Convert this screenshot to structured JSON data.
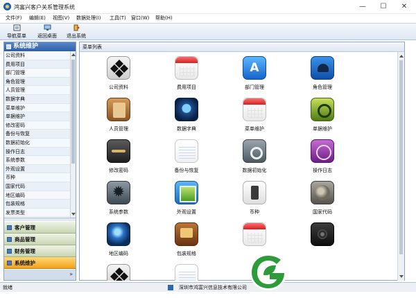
{
  "window": {
    "title": "鸿富兴客户关系管理系统",
    "controls": [
      "—",
      "☐",
      "✕"
    ]
  },
  "menu": [
    "文件(F)",
    "编辑(E)",
    "视图(V)",
    "数据处理(I)",
    "工具(T)",
    "窗口(W)",
    "帮助(H)"
  ],
  "toolbar": {
    "nav_menu": "导航菜单",
    "back_desktop": "返回桌面",
    "exit_system": "退出系统"
  },
  "sidebar": {
    "header": "系统维护",
    "items": [
      "公司资料",
      "费用项目",
      "部门管理",
      "角色管理",
      "人员管理",
      "数据字典",
      "菜单维护",
      "单据维护",
      "修改密码",
      "备份与恢复",
      "数据初始化",
      "操作日志",
      "系统参数",
      "外观设置",
      "币种",
      "国家代码",
      "地区编码",
      "包装规格",
      "发票类型"
    ],
    "sections": [
      {
        "label": "客户管理",
        "active": false
      },
      {
        "label": "商品管理",
        "active": false
      },
      {
        "label": "财务管理",
        "active": false
      },
      {
        "label": "系统维护",
        "active": true
      }
    ]
  },
  "main": {
    "header": "菜单列表",
    "tiles": [
      {
        "label": "公司资料",
        "icon": "black-diamond-icon"
      },
      {
        "label": "费用项目",
        "icon": "calendar-icon"
      },
      {
        "label": "部门管理",
        "icon": "app-store-icon"
      },
      {
        "label": "角色管理",
        "icon": "people-icon"
      },
      {
        "label": "人员管理",
        "icon": "address-book-icon"
      },
      {
        "label": "数据字典",
        "icon": "globe-icon"
      },
      {
        "label": "菜单维护",
        "icon": "calendar-icon"
      },
      {
        "label": "单据维护",
        "icon": "headphones-icon"
      },
      {
        "label": "修改密码",
        "icon": "key-icon"
      },
      {
        "label": "备份与恢复",
        "icon": "notebook-icon"
      },
      {
        "label": "数据初始化",
        "icon": "steam-icon"
      },
      {
        "label": "操作日志",
        "icon": "clock-icon"
      },
      {
        "label": "系统参数",
        "icon": "gear-icon"
      },
      {
        "label": "外观设置",
        "icon": "picture-frame-icon"
      },
      {
        "label": "币种",
        "icon": "switch-icon"
      },
      {
        "label": "国家代码",
        "icon": "map-icon"
      },
      {
        "label": "地区编码",
        "icon": "earth-icon"
      },
      {
        "label": "包装规格",
        "icon": "brown-app-icon"
      },
      {
        "label": "",
        "icon": "calendar-icon"
      },
      {
        "label": "",
        "icon": "speaker-icon"
      },
      {
        "label": "",
        "icon": "black-diamond-icon"
      },
      {
        "label": "",
        "icon": "notebook-icon"
      }
    ]
  },
  "status": {
    "left": "就绪",
    "company": "深圳市鸿富兴信息技术有限公司"
  },
  "colors": {
    "accent_blue": "#2f5fa8",
    "active_section": "#f0a21d",
    "logo_green": "#2e9b3a"
  }
}
